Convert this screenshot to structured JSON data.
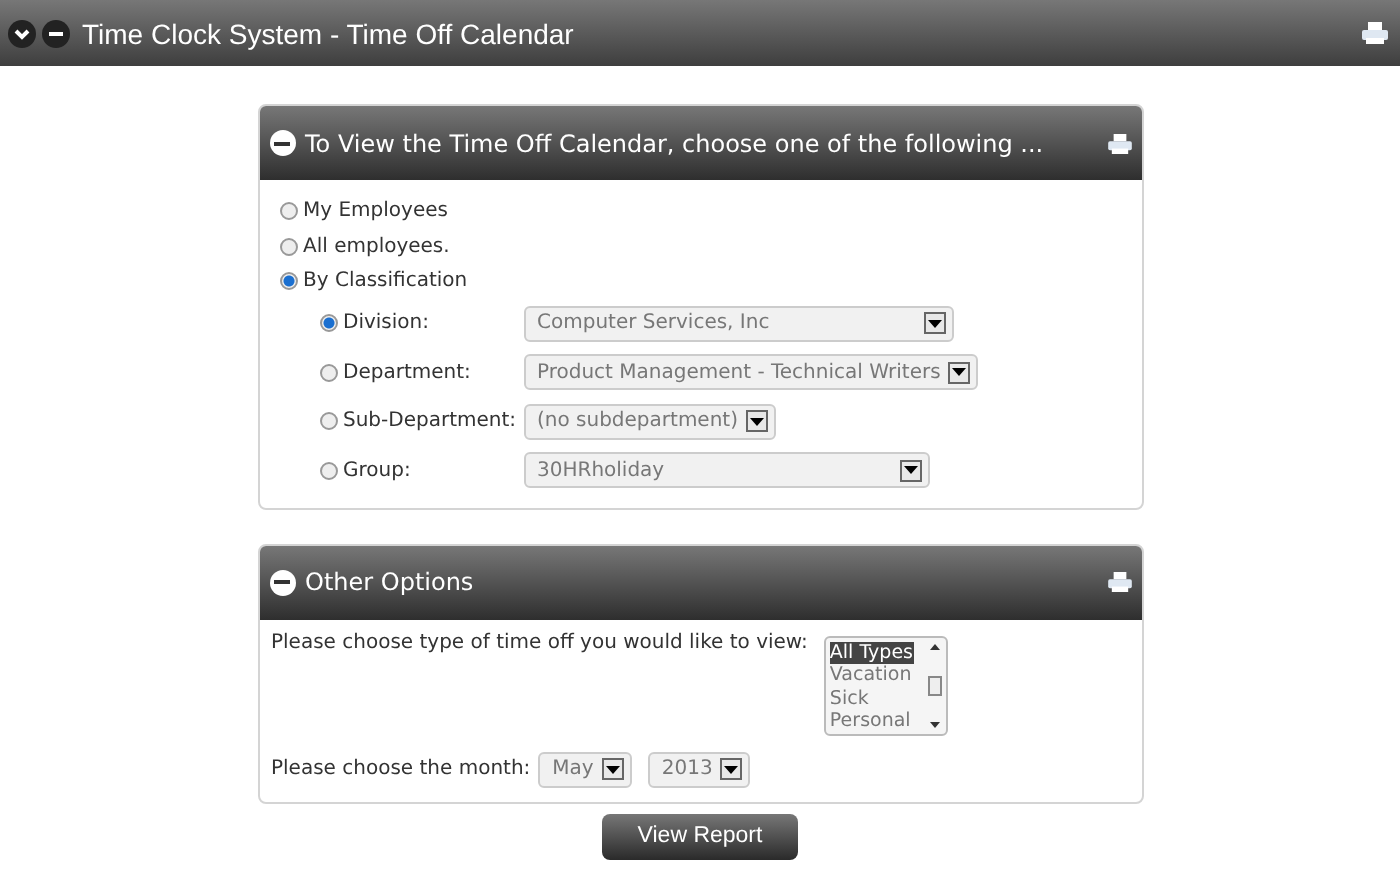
{
  "window": {
    "title": "Time Clock System - Time Off Calendar"
  },
  "view_panel": {
    "title": "To View the Time Off Calendar, choose one of the following ...",
    "options": [
      {
        "label": "My Employees",
        "selected": false
      },
      {
        "label": "All employees.",
        "selected": false
      },
      {
        "label": "By Classification",
        "selected": true
      }
    ],
    "filters": [
      {
        "label": "Division:",
        "value": "Computer Services, Inc",
        "selected": true
      },
      {
        "label": "Department:",
        "value": "Product Management - Technical Writers",
        "selected": false
      },
      {
        "label": "Sub-Department:",
        "value": "(no subdepartment)",
        "selected": false
      },
      {
        "label": "Group:",
        "value": "30HRholiday",
        "selected": false
      }
    ]
  },
  "other_panel": {
    "title": "Other Options",
    "type_label": "Please choose type of time off you would like to view:",
    "types": [
      {
        "label": "All Types",
        "selected": true
      },
      {
        "label": "Vacation",
        "selected": false
      },
      {
        "label": "Sick",
        "selected": false
      },
      {
        "label": "Personal",
        "selected": false
      }
    ],
    "month_label": "Please choose the month:",
    "month": "May",
    "year": "2013"
  },
  "button": "View Report"
}
